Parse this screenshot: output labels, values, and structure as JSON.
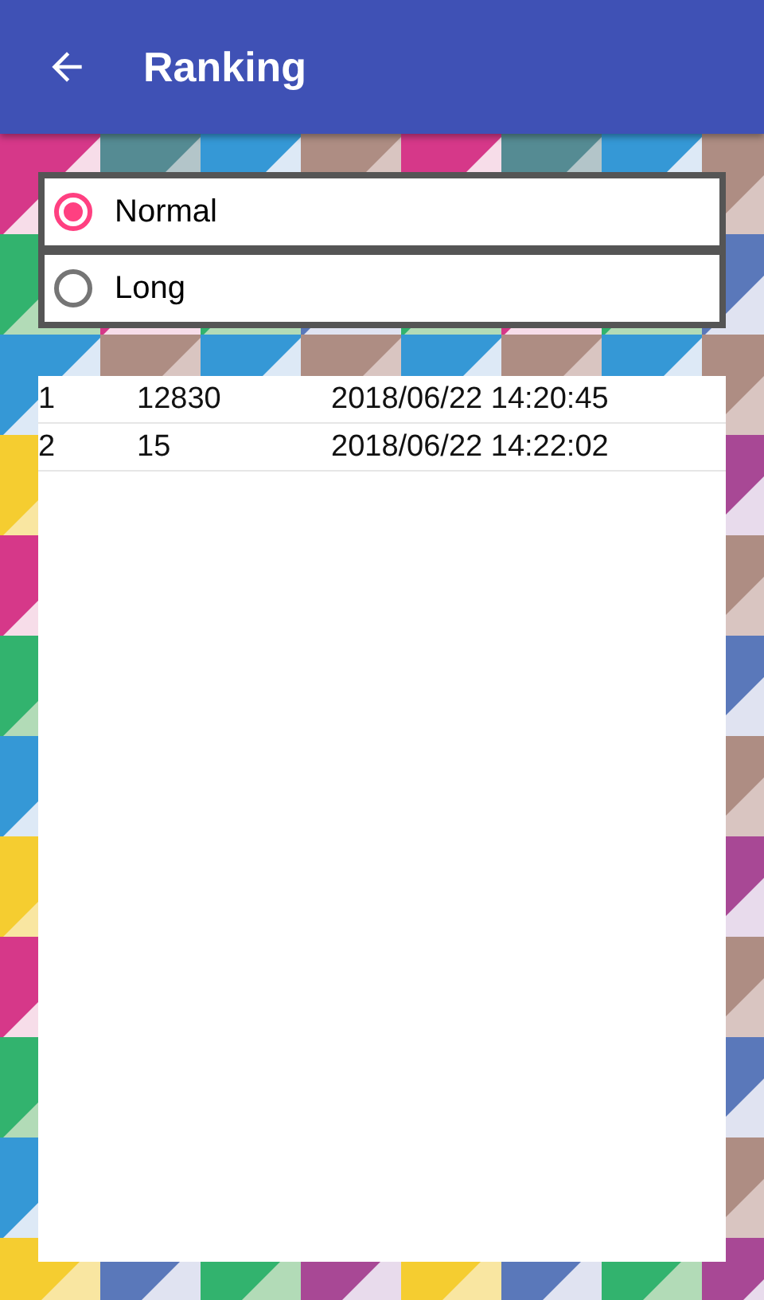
{
  "app_bar": {
    "title": "Ranking"
  },
  "modes": [
    {
      "label": "Normal",
      "selected": true
    },
    {
      "label": "Long",
      "selected": false
    }
  ],
  "ranking": {
    "rows": [
      {
        "rank": "1",
        "score": "12830",
        "date": "2018/06/22 14:20:45"
      },
      {
        "rank": "2",
        "score": "15",
        "date": "2018/06/22 14:22:02"
      }
    ]
  }
}
